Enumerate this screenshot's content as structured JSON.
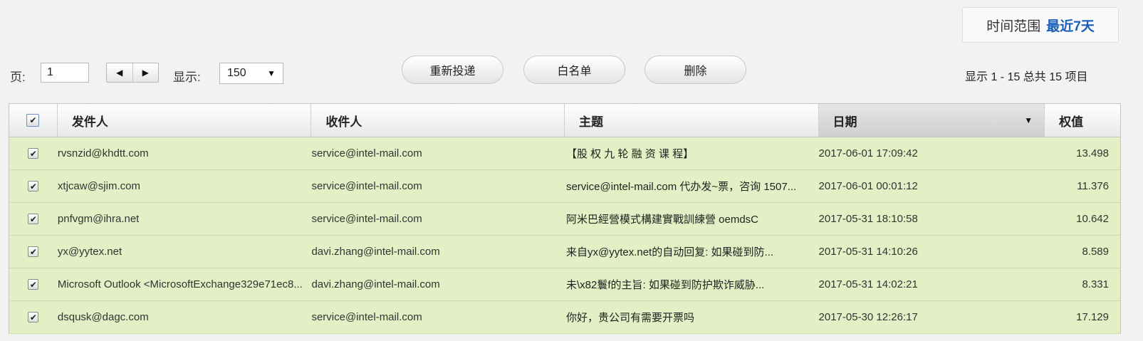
{
  "time_range": {
    "label": "时间范围",
    "value": "最近7天"
  },
  "toolbar": {
    "page_label": "页:",
    "page_value": "1",
    "show_label": "显示:",
    "per_page": "150",
    "redeliver_label": "重新投递",
    "whitelist_label": "白名单",
    "delete_label": "删除",
    "summary": "显示 1 - 15 总共 15 项目"
  },
  "grid": {
    "columns": {
      "from": "发件人",
      "to": "收件人",
      "subject": "主题",
      "date": "日期",
      "score": "权值"
    },
    "rows": [
      {
        "from": "rvsnzid@khdtt.com",
        "to": "service@intel-mail.com",
        "subject": "【股 权 九 轮 融 资 课 程】",
        "date": "2017-06-01 17:09:42",
        "score": "13.498"
      },
      {
        "from": "xtjcaw@sjim.com",
        "to": "service@intel-mail.com",
        "subject": "service@intel-mail.com 代办发~票，咨询 1507...",
        "date": "2017-06-01 00:01:12",
        "score": "11.376"
      },
      {
        "from": "pnfvgm@ihra.net",
        "to": "service@intel-mail.com",
        "subject": "阿米巴經營模式構建實戰訓練營 oemdsC",
        "date": "2017-05-31 18:10:58",
        "score": "10.642"
      },
      {
        "from": "yx@yytex.net",
        "to": "davi.zhang@intel-mail.com",
        "subject": "来自yx@yytex.net的自动回复: 如果碰到防...",
        "date": "2017-05-31 14:10:26",
        "score": "8.589"
      },
      {
        "from": "Microsoft Outlook <MicrosoftExchange329e71ec8...",
        "to": "davi.zhang@intel-mail.com",
        "subject": "未\\x82鬟f的主旨: 如果碰到防护欺诈威胁...",
        "date": "2017-05-31 14:02:21",
        "score": "8.331"
      },
      {
        "from": "dsqusk@dagc.com",
        "to": "service@intel-mail.com",
        "subject": "你好，贵公司有需要开票吗",
        "date": "2017-05-30 12:26:17",
        "score": "17.129"
      }
    ]
  },
  "icons": {
    "checkbox_checked": "✔",
    "prev": "◀",
    "next": "▶",
    "dropdown": "▼"
  },
  "colors": {
    "row_highlight": "#e3efc4",
    "accent": "#1a5eb8"
  }
}
